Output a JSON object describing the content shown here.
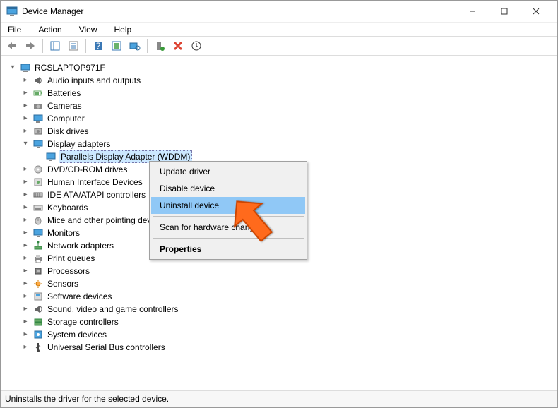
{
  "window": {
    "title": "Device Manager"
  },
  "menubar": {
    "file": "File",
    "action": "Action",
    "view": "View",
    "help": "Help"
  },
  "tree": {
    "root": "RCSLAPTOP971F",
    "nodes": [
      {
        "label": "Audio inputs and outputs",
        "expanded": false
      },
      {
        "label": "Batteries",
        "expanded": false
      },
      {
        "label": "Cameras",
        "expanded": false
      },
      {
        "label": "Computer",
        "expanded": false
      },
      {
        "label": "Disk drives",
        "expanded": false
      },
      {
        "label": "Display adapters",
        "expanded": true,
        "children": [
          {
            "label": "Parallels Display Adapter (WDDM)",
            "selected": true
          }
        ]
      },
      {
        "label": "DVD/CD-ROM drives",
        "expanded": false
      },
      {
        "label": "Human Interface Devices",
        "expanded": false
      },
      {
        "label": "IDE ATA/ATAPI controllers",
        "expanded": false
      },
      {
        "label": "Keyboards",
        "expanded": false
      },
      {
        "label": "Mice and other pointing devices",
        "expanded": false
      },
      {
        "label": "Monitors",
        "expanded": false
      },
      {
        "label": "Network adapters",
        "expanded": false
      },
      {
        "label": "Print queues",
        "expanded": false
      },
      {
        "label": "Processors",
        "expanded": false
      },
      {
        "label": "Sensors",
        "expanded": false
      },
      {
        "label": "Software devices",
        "expanded": false
      },
      {
        "label": "Sound, video and game controllers",
        "expanded": false
      },
      {
        "label": "Storage controllers",
        "expanded": false
      },
      {
        "label": "System devices",
        "expanded": false
      },
      {
        "label": "Universal Serial Bus controllers",
        "expanded": false
      }
    ]
  },
  "context_menu": {
    "update": "Update driver",
    "disable": "Disable device",
    "uninstall": "Uninstall device",
    "scan": "Scan for hardware changes",
    "properties": "Properties"
  },
  "status": {
    "text": "Uninstalls the driver for the selected device."
  },
  "icons": {
    "speaker": "speaker-icon",
    "battery": "battery-icon",
    "camera": "camera-icon",
    "computer": "computer-icon",
    "disk": "disk-icon",
    "display": "display-icon",
    "dvd": "dvd-icon",
    "hid": "hid-icon",
    "ide": "ide-icon",
    "keyboard": "keyboard-icon",
    "mouse": "mouse-icon",
    "monitor": "monitor-icon",
    "network": "network-icon",
    "printer": "printer-icon",
    "processor": "processor-icon",
    "sensor": "sensor-icon",
    "software": "software-icon",
    "sound": "sound-icon",
    "storage": "storage-icon",
    "system": "system-icon",
    "usb": "usb-icon"
  }
}
